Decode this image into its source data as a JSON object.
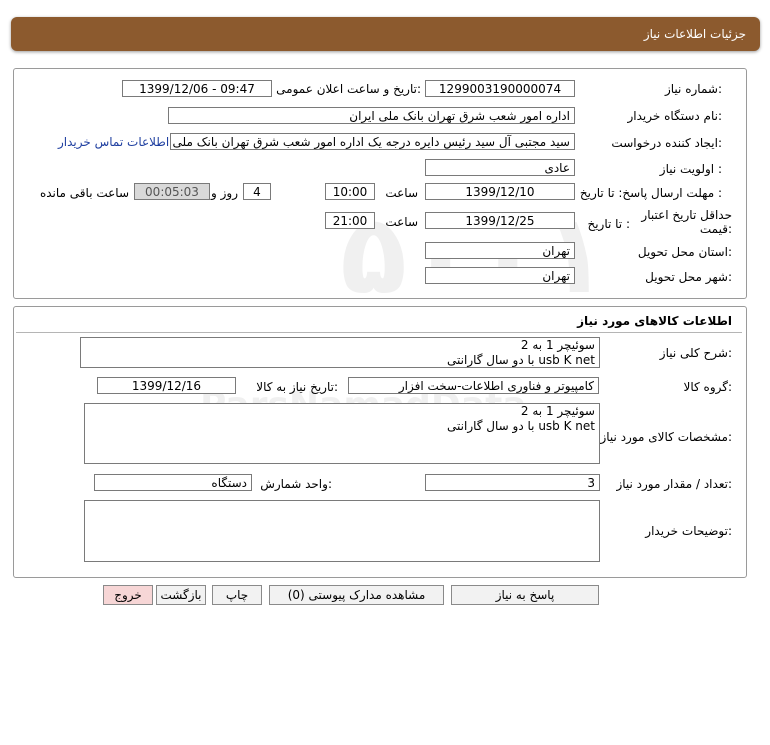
{
  "header": {
    "title": "جزئیات اطلاعات نیاز"
  },
  "info": {
    "need_number_label": "شماره نیاز:",
    "need_number": "1299003190000074",
    "announce_label": "تاریخ و ساعت اعلان عمومی:",
    "announce_value": "1399/12/06 - 09:47",
    "buyer_org_label": "نام دستگاه خریدار:",
    "buyer_org": "اداره امور شعب شرق تهران بانک ملی ایران",
    "creator_label": "ایجاد کننده درخواست:",
    "creator": "سید مجتبی  آل سید  رئیس دایره درجه یک  اداره امور شعب شرق تهران بانک ملی ایران",
    "contact_link": "اطلاعات تماس خریدار",
    "priority_label": "اولویت نیاز :",
    "priority": "عادی",
    "send_deadline_label": "مهلت ارسال پاسخ:  تا تاریخ :",
    "send_date": "1399/12/10",
    "time_label": "ساعت",
    "send_time": "10:00",
    "days": "4",
    "days_label": "روز و",
    "remaining": "00:05:03",
    "remaining_label": "ساعت باقی مانده",
    "validity_label": "حداقل تاریخ اعتبار قیمت:",
    "validity_to_label": "تا تاریخ :",
    "validity_date": "1399/12/25",
    "validity_time_label": "ساعت",
    "validity_time": "21:00",
    "province_label": "استان محل تحویل:",
    "province": "تهران",
    "city_label": "شهر محل تحویل:",
    "city": "تهران"
  },
  "goods": {
    "title": "اطلاعات کالاهای مورد نیاز",
    "desc_label": "شرح کلی نیاز:",
    "desc_line1": "سوئیچر  1  به  2",
    "desc_line2": "usb   K net   با دو سال گارانتی",
    "group_label": "گروه کالا:",
    "group": "کامپیوتر و فناوری اطلاعات-سخت افزار",
    "need_date_label": "تاریخ نیاز به کالا:",
    "need_date": "1399/12/16",
    "spec_label": "مشخصات کالای مورد نیاز:",
    "spec_line1": "سوئیچر  1  به  2",
    "spec_line2": "usb   K net   با دو سال گارانتی",
    "qty_label": "تعداد / مقدار مورد نیاز:",
    "qty": "3",
    "unit_label": "واحد شمارش:",
    "unit": "دستگاه",
    "buyer_notes_label": "توضیحات خریدار:",
    "buyer_notes": ""
  },
  "buttons": {
    "reply": "پاسخ به نیاز",
    "attachments": "مشاهده مدارک پیوستی (0)",
    "print": "چاپ",
    "back": "بازگشت",
    "exit": "خروج"
  }
}
